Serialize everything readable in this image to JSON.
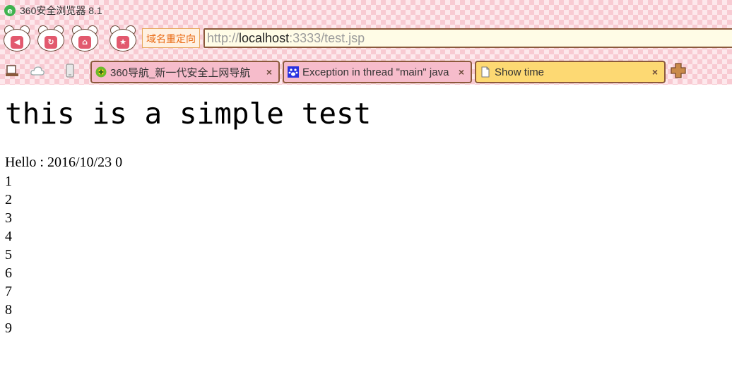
{
  "window": {
    "title": "360安全浏览器 8.1",
    "logo_glyph": "e"
  },
  "nav": {
    "buttons": [
      {
        "name": "back",
        "glyph": "◀"
      },
      {
        "name": "refresh",
        "glyph": "↻"
      },
      {
        "name": "home",
        "glyph": "⌂"
      },
      {
        "name": "favorite",
        "glyph": "★"
      }
    ],
    "redirect_label": "域名重定向",
    "address": {
      "scheme": "http://",
      "host": "localhost",
      "path": ":3333/test.jsp"
    }
  },
  "toolbar": {
    "tools": [
      "restore-icon",
      "cloud-icon",
      "phone-icon"
    ],
    "tabs": [
      {
        "label": "360导航_新一代安全上网导航",
        "icon": "360-logo-icon",
        "active": false
      },
      {
        "label": "Exception in thread \"main\" java",
        "icon": "baidu-paw-icon",
        "active": false
      },
      {
        "label": "Show time",
        "icon": "page-icon",
        "active": true
      }
    ],
    "close_glyph": "×",
    "new_tab_icon": "plus-icon"
  },
  "page": {
    "heading": "this is a simple test",
    "hello": "Hello : 2016/10/23 0",
    "counters": [
      "1",
      "2",
      "3",
      "4",
      "5",
      "6",
      "7",
      "8",
      "9"
    ]
  },
  "colors": {
    "chrome_bg": "#fde8ec",
    "tab_inactive": "#f6bccb",
    "tab_active": "#fdd973",
    "border_brown": "#8b5a3c",
    "redirect_text": "#ea6a14"
  }
}
